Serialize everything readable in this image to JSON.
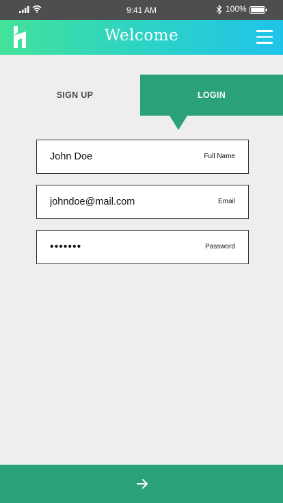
{
  "status_bar": {
    "time": "9:41 AM",
    "battery_percent": "100%",
    "icons": [
      "signal-icon",
      "wifi-icon",
      "bluetooth-icon",
      "battery-icon"
    ]
  },
  "header": {
    "title": "Welcome",
    "logo_icon": "brand-logo-icon",
    "menu_icon": "hamburger-menu-icon"
  },
  "tabs": [
    {
      "label": "SIGN UP",
      "active": false
    },
    {
      "label": "LOGIN",
      "active": true
    }
  ],
  "form": {
    "fields": [
      {
        "value": "John Doe",
        "label": "Full Name"
      },
      {
        "value": "johndoe@mail.com",
        "label": "Email"
      },
      {
        "value": "•••••••",
        "label": "Password"
      }
    ]
  },
  "submit": {
    "icon": "arrow-right-icon"
  },
  "colors": {
    "accent": "#2ba17b",
    "header_gradient_start": "#43e29a",
    "header_gradient_end": "#1ec3ea",
    "background": "#eeeeee",
    "status_bar": "#4e4e4e"
  }
}
